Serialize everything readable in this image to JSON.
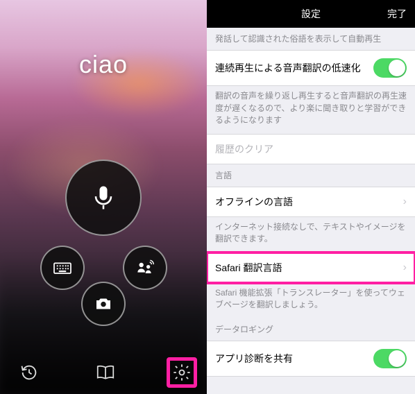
{
  "left": {
    "display_word": "ciao",
    "buttons": {
      "mic": "microphone-icon",
      "keyboard": "keyboard-icon",
      "camera": "camera-icon",
      "speaker": "speaker-icon"
    },
    "bottom": {
      "history": "history-icon",
      "book": "book-icon",
      "settings": "gear-icon"
    }
  },
  "right": {
    "nav_title": "設定",
    "nav_done": "完了",
    "sec1_header": "発話して認識された俗語を表示して自動再生",
    "row_slow": "連続再生による音声翻訳の低速化",
    "sec1_footer": "翻訳の音声を繰り返し再生すると音声翻訳の再生速度が遅くなるので、より楽に聞き取りと学習ができるようになります",
    "row_clear": "履歴のクリア",
    "sec_lang_header": "言語",
    "row_offline": "オフラインの言語",
    "offline_footer": "インターネット接続なしで、テキストやイメージを翻訳できます。",
    "row_safari": "Safari 翻訳言語",
    "safari_footer": "Safari 機能拡張「トランスレーター」を使ってウェブページを翻訳しましょう。",
    "sec_log_header": "データロギング",
    "row_diag": "アプリ診断を共有"
  },
  "switches": {
    "slow": true,
    "diag": true
  },
  "colors": {
    "accent": "#4cd964",
    "highlight": "#ff1fa3"
  }
}
